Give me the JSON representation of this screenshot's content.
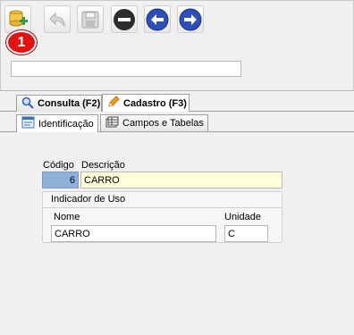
{
  "toolbar": {
    "buttons": [
      {
        "name": "add-record-icon"
      },
      {
        "name": "undo-icon"
      },
      {
        "name": "save-disk-icon"
      },
      {
        "name": "delete-minus-icon"
      },
      {
        "name": "arrow-left-icon"
      },
      {
        "name": "arrow-right-icon"
      }
    ],
    "badge": "1",
    "search_value": ""
  },
  "tabs": {
    "consulta": "Consulta (F2)",
    "cadastro": "Cadastro (F3)"
  },
  "subtabs": {
    "identificacao": "Identificação",
    "campos": "Campos e Tabelas"
  },
  "form": {
    "codigo_label": "Código",
    "codigo_value": "6",
    "descricao_label": "Descrição",
    "descricao_value": "CARRO",
    "group_title": "Indicador de Uso",
    "nome_label": "Nome",
    "nome_value": "CARRO",
    "unidade_label": "Unidade",
    "unidade_value": "C"
  },
  "colors": {
    "codigo_bg": "#8fb0d9",
    "descricao_bg": "#ffffd9",
    "badge_bg": "#e01212",
    "nav_blue": "#2e4fb8"
  }
}
